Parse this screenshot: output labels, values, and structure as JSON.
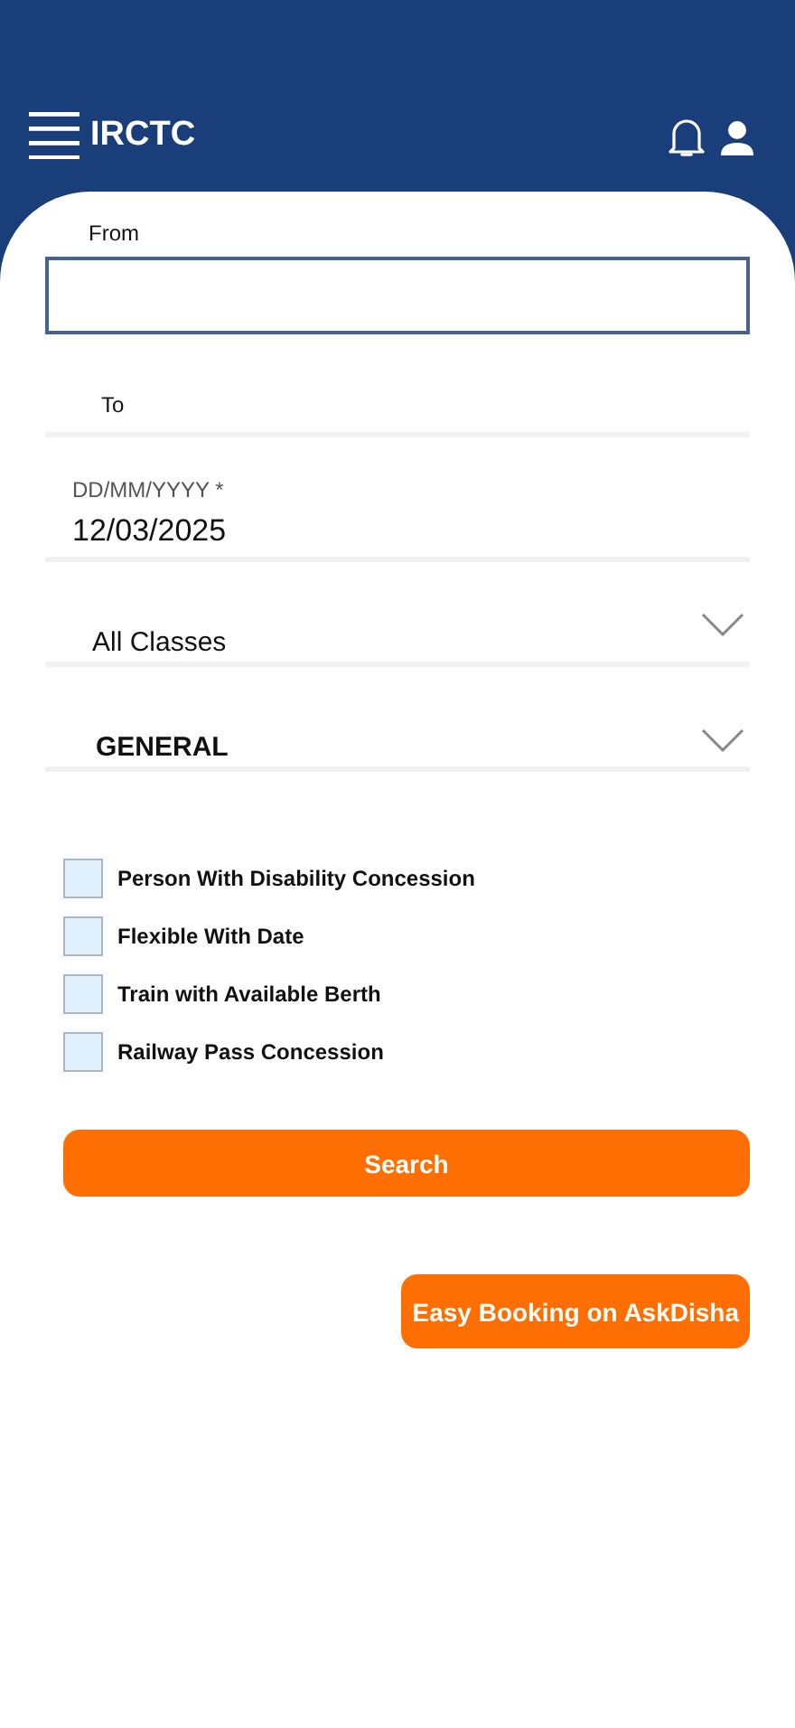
{
  "header": {
    "title": "IRCTC"
  },
  "form": {
    "from": {
      "label": "From"
    },
    "to": {
      "label": "To"
    },
    "date": {
      "label": "DD/MM/YYYY *",
      "value": "12/03/2025"
    },
    "selects": [
      {
        "value": "All Classes",
        "kind": "class"
      },
      {
        "value": "GENERAL",
        "kind": "quota"
      }
    ],
    "options": [
      {
        "label": "Person With Disability Concession",
        "checked": false
      },
      {
        "label": "Flexible With Date",
        "checked": false
      },
      {
        "label": "Train with Available Berth",
        "checked": false
      },
      {
        "label": "Railway Pass Concession",
        "checked": false
      }
    ],
    "search_button": "Search",
    "askdisha_button": "Easy Booking on AskDisha"
  }
}
